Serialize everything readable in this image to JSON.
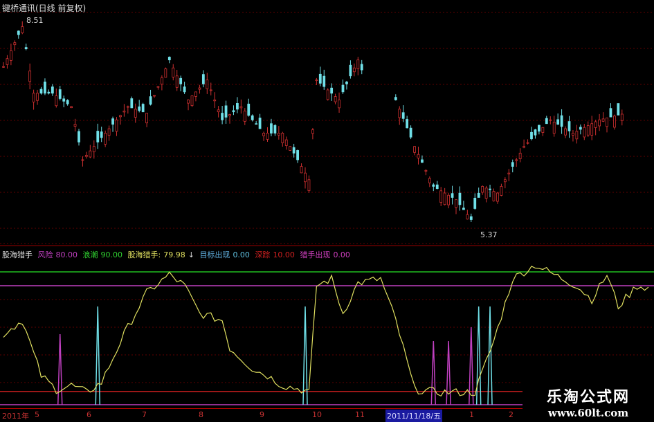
{
  "title": "键桥通讯(日线 前复权)",
  "price_high_label": "8.51",
  "price_low_label": "5.37",
  "legend": {
    "name": "股海猎手",
    "risk_label": "风险",
    "risk_value": "80.00",
    "wave_label": "浪潮",
    "wave_value": "90.00",
    "hunter_label": "股海猎手:",
    "hunter_value": "79.98",
    "target_label": "目标出现",
    "target_value": "0.00",
    "track_label": "深踪",
    "track_value": "10.00",
    "hunter_appear_label": "猎手出现",
    "hunter_appear_value": "0.00"
  },
  "axis": {
    "ticks": [
      "2011年",
      "5",
      "6",
      "7",
      "8",
      "9",
      "10",
      "11",
      "1",
      "2"
    ],
    "cursor_date": "2011/11/18/五"
  },
  "watermark": {
    "name": "乐淘公式网",
    "url": "www.60lt.com"
  },
  "colors": {
    "up": "#d03030",
    "down": "#70e0e8",
    "line": "#e0e060",
    "green": "#20c020",
    "magenta": "#c040c0",
    "grid": "#600000"
  },
  "chart_data": {
    "type": "candlestick",
    "price_range": [
      5.37,
      8.51
    ],
    "segments": [
      [
        [
          0,
          7.8
        ],
        [
          5,
          8.4
        ],
        [
          8,
          7.4
        ],
        [
          13,
          7.4
        ],
        [
          18,
          7.2
        ],
        [
          21,
          6.4
        ],
        [
          27,
          6.8
        ],
        [
          33,
          7.2
        ],
        [
          38,
          7.1
        ],
        [
          44,
          7.9
        ],
        [
          49,
          7.3
        ],
        [
          54,
          7.6
        ],
        [
          58,
          7.0
        ],
        [
          63,
          7.2
        ],
        [
          69,
          6.8
        ],
        [
          74,
          6.8
        ],
        [
          79,
          6.3
        ],
        [
          81,
          6.1
        ],
        [
          83,
          7.6
        ],
        [
          89,
          7.3
        ],
        [
          94,
          7.9
        ],
        [
          96,
          7.6
        ]
      ],
      [
        [
          104,
          7.3
        ],
        [
          109,
          6.6
        ],
        [
          114,
          6.0
        ],
        [
          120,
          5.8
        ],
        [
          124,
          5.5
        ],
        [
          127,
          6.0
        ],
        [
          131,
          5.9
        ],
        [
          138,
          6.6
        ],
        [
          145,
          7.0
        ],
        [
          151,
          6.8
        ],
        [
          158,
          7.0
        ],
        [
          165,
          7.1
        ]
      ]
    ],
    "indicator": [
      [
        0,
        45
      ],
      [
        5,
        55
      ],
      [
        10,
        15
      ],
      [
        14,
        5
      ],
      [
        18,
        8
      ],
      [
        22,
        3
      ],
      [
        26,
        10
      ],
      [
        32,
        45
      ],
      [
        38,
        75
      ],
      [
        44,
        88
      ],
      [
        48,
        80
      ],
      [
        52,
        60
      ],
      [
        58,
        55
      ],
      [
        60,
        35
      ],
      [
        66,
        20
      ],
      [
        70,
        15
      ],
      [
        74,
        8
      ],
      [
        79,
        5
      ],
      [
        81,
        3
      ],
      [
        83,
        80
      ],
      [
        87,
        85
      ],
      [
        90,
        60
      ],
      [
        94,
        82
      ],
      [
        100,
        85
      ],
      [
        104,
        55
      ],
      [
        109,
        5
      ],
      [
        115,
        3
      ],
      [
        125,
        3
      ],
      [
        130,
        40
      ],
      [
        135,
        85
      ],
      [
        141,
        95
      ],
      [
        146,
        88
      ],
      [
        152,
        80
      ],
      [
        156,
        70
      ],
      [
        160,
        88
      ],
      [
        163,
        65
      ],
      [
        168,
        80
      ],
      [
        172,
        78
      ]
    ],
    "spikes": [
      [
        15,
        45,
        "magenta"
      ],
      [
        25,
        65,
        "cyan"
      ],
      [
        80,
        65,
        "cyan"
      ],
      [
        114,
        40,
        "magenta"
      ],
      [
        118,
        40,
        "magenta"
      ],
      [
        124,
        50,
        "magenta"
      ],
      [
        126,
        65,
        "cyan"
      ],
      [
        129,
        65,
        "cyan"
      ]
    ]
  }
}
